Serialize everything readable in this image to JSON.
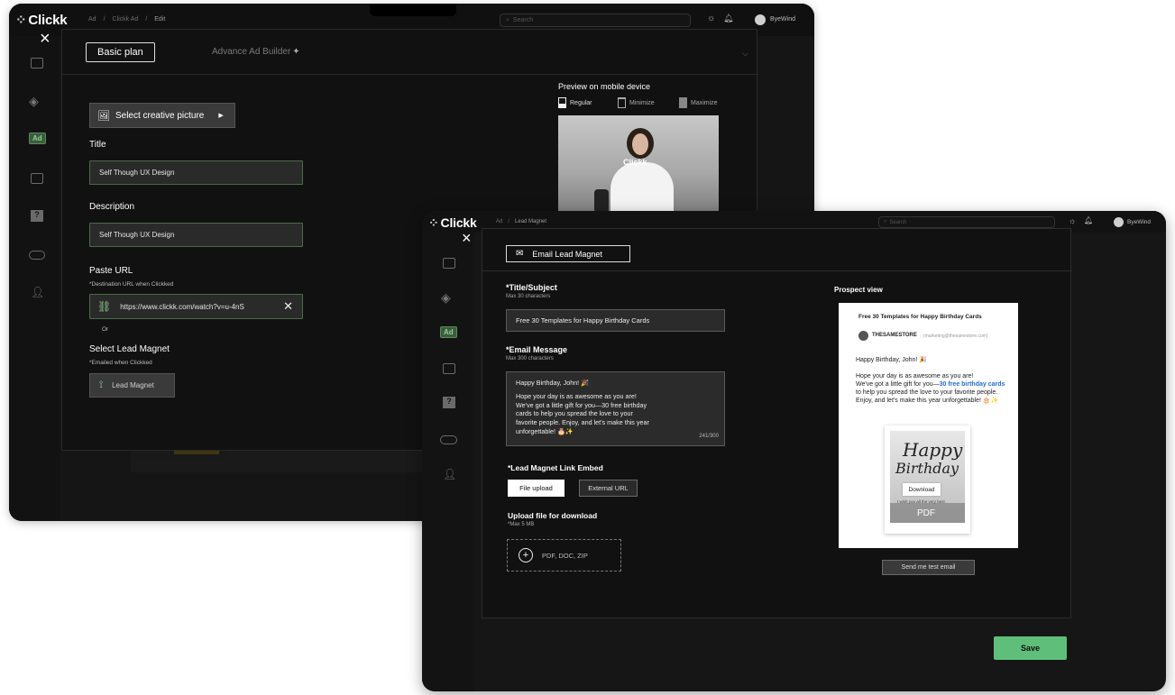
{
  "back": {
    "logo": "Clickk",
    "breadcrumb": [
      "Ad",
      "/",
      "Clickk Ad",
      "/",
      "Edit"
    ],
    "search_placeholder": "Search",
    "user_name": "ByeWind",
    "close_label": "×",
    "tab_basic": "Basic plan",
    "tab_advance": "Advance Ad Builder",
    "select_creative": "Select creative picture",
    "title_label": "Title",
    "title_value": "Self Though UX Design",
    "description_label": "Description",
    "description_value": "Self Though UX Design",
    "paste_url_label": "Paste URL",
    "destination_note": "*Destination URL when Clickked",
    "url_value": "https://www.clickk.com/watch?v=u-4nS",
    "or_label": "Or",
    "lead_magnet_label": "Select Lead Magnet",
    "emailed_note": "*Emailed when Clickked",
    "lead_magnet_button": "Lead Magnet",
    "preview_title": "Preview on mobile device",
    "preview_options": [
      "Regular",
      "Minimize",
      "Maximize"
    ],
    "preview_watermark": "Clickk"
  },
  "front": {
    "logo": "Clickk",
    "breadcrumb": [
      "Ad",
      "/",
      "Lead Magnet"
    ],
    "search_placeholder": "Search",
    "user_name": "ByeWind",
    "close_label": "×",
    "header_button": "Email Lead Magnet",
    "title_subject_label": "*Title/Subject",
    "title_max": "Max 30 characters",
    "title_value": "Free 30 Templates for Happy Birthday Cards",
    "email_message_label": "*Email Message",
    "message_max": "Max 300 characters",
    "message_lines": [
      "Happy Birthday, John! 🎉",
      "",
      "Hope your day is as awesome as you are!",
      "We've got a little gift for you—30 free birthday",
      "cards to help you spread the love to your",
      "favorite people. Enjoy, and let's make this year",
      "unforgettable! 🎂✨"
    ],
    "message_count": "241/300",
    "link_embed_label": "*Lead Magnet Link Embed",
    "file_upload": "File upload",
    "external_url": "External URL",
    "upload_label": "Upload file for download",
    "upload_max": "*Max 5 MB",
    "upload_types": "PDF, DOC, ZIP",
    "prospect_label": "Prospect view",
    "prospect": {
      "subject": "Free 30 Templates for Happy Birthday Cards",
      "sender": "THESAMESTORE",
      "sender_email": "(marketing@thesamestore.com)",
      "greeting": "Happy Birthday, John! 🎉",
      "body_1": "Hope your day is as awesome as you are!",
      "body_2": "We've got a little gift for you—",
      "body_link": "30 free birthday cards",
      "body_3": " to help you spread the love to your favorite people. Enjoy, and let's make this year unforgettable! 🎂✨",
      "card_text_1": "Happy",
      "card_text_2": "Birthday",
      "card_small": "I wish you all the very best",
      "download": "Download",
      "pdf": "PDF"
    },
    "send_test": "Send me test email",
    "save": "Save"
  },
  "colors": {
    "accent_green": "#5fbf7a",
    "link_blue": "#1f6fd1",
    "ad_badge": "#8fd08f"
  },
  "icons": [
    "search-icon",
    "sun-icon",
    "bell-icon",
    "avatar-icon",
    "close-icon",
    "sparkle-icon",
    "picture-icon",
    "link-icon",
    "magnet-icon",
    "mail-icon",
    "plus-icon",
    "rail-monitor-icon",
    "rail-layers-icon",
    "rail-ad-icon",
    "rail-image-icon",
    "rail-help-icon",
    "rail-gamepad-icon",
    "rail-users-icon"
  ]
}
